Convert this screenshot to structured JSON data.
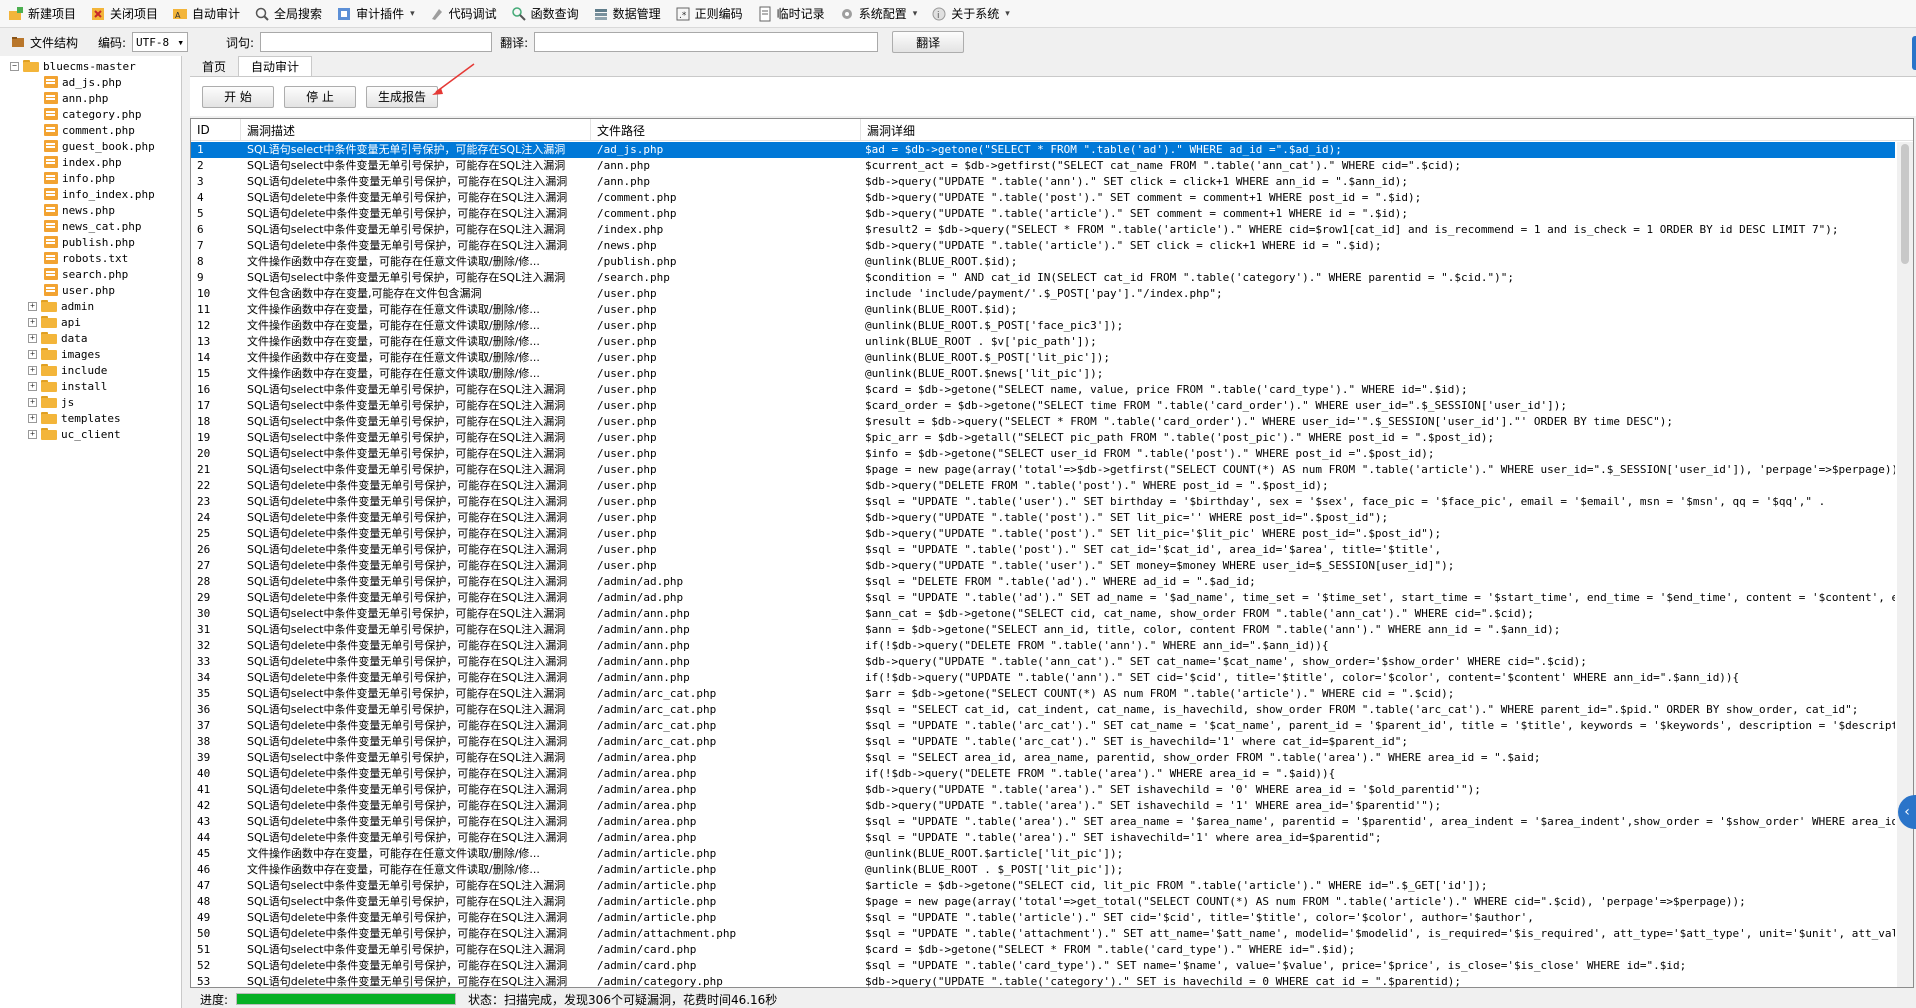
{
  "toolbar": {
    "items": [
      {
        "label": "新建项目",
        "icon": "new-project-icon",
        "caret": false
      },
      {
        "label": "关闭项目",
        "icon": "close-project-icon",
        "caret": false
      },
      {
        "label": "自动审计",
        "icon": "auto-audit-icon",
        "caret": false
      },
      {
        "label": "全局搜索",
        "icon": "global-search-icon",
        "caret": false
      },
      {
        "label": "审计插件",
        "icon": "audit-plugin-icon",
        "caret": true
      },
      {
        "label": "代码调试",
        "icon": "code-debug-icon",
        "caret": false
      },
      {
        "label": "函数查询",
        "icon": "function-query-icon",
        "caret": false
      },
      {
        "label": "数据管理",
        "icon": "data-manage-icon",
        "caret": false
      },
      {
        "label": "正则编码",
        "icon": "regex-encode-icon",
        "caret": false
      },
      {
        "label": "临时记录",
        "icon": "temp-record-icon",
        "caret": false
      },
      {
        "label": "系统配置",
        "icon": "system-config-icon",
        "caret": true
      },
      {
        "label": "关于系统",
        "icon": "about-system-icon",
        "caret": true
      }
    ]
  },
  "topbar": {
    "panel_title": "文件结构",
    "encoding_label": "编码:",
    "encoding_value": "UTF-8",
    "query_label": "词句:",
    "translate_label": "翻译:",
    "translate_button": "翻译"
  },
  "tree": {
    "root": "bluecms-master",
    "files": [
      "ad_js.php",
      "ann.php",
      "category.php",
      "comment.php",
      "guest_book.php",
      "index.php",
      "info.php",
      "info_index.php",
      "news.php",
      "news_cat.php",
      "publish.php",
      "robots.txt",
      "search.php",
      "user.php"
    ],
    "folders": [
      "admin",
      "api",
      "data",
      "images",
      "include",
      "install",
      "js",
      "templates",
      "uc_client"
    ]
  },
  "tabs": [
    {
      "label": "首页",
      "active": false
    },
    {
      "label": "自动审计",
      "active": true
    }
  ],
  "controls": {
    "start": "开 始",
    "stop": "停 止",
    "report": "生成报告"
  },
  "grid": {
    "columns": [
      "ID",
      "漏洞描述",
      "文件路径",
      "漏洞详细"
    ],
    "selected_index": 0,
    "rows": [
      [
        "1",
        "SQL语句select中条件变量无单引号保护，可能存在SQL注入漏洞",
        "/ad_js.php",
        "$ad = $db->getone(\"SELECT * FROM \".table('ad').\" WHERE ad_id =\".$ad_id);"
      ],
      [
        "2",
        "SQL语句select中条件变量无单引号保护，可能存在SQL注入漏洞",
        "/ann.php",
        "$current_act = $db->getfirst(\"SELECT cat_name FROM \".table('ann_cat').\" WHERE cid=\".$cid);"
      ],
      [
        "3",
        "SQL语句delete中条件变量无单引号保护，可能存在SQL注入漏洞",
        "/ann.php",
        "$db->query(\"UPDATE \".table('ann').\" SET click = click+1 WHERE ann_id = \".$ann_id);"
      ],
      [
        "4",
        "SQL语句delete中条件变量无单引号保护，可能存在SQL注入漏洞",
        "/comment.php",
        "$db->query(\"UPDATE \".table('post').\" SET comment = comment+1 WHERE post_id = \".$id);"
      ],
      [
        "5",
        "SQL语句delete中条件变量无单引号保护，可能存在SQL注入漏洞",
        "/comment.php",
        "$db->query(\"UPDATE \".table('article').\" SET comment = comment+1 WHERE id = \".$id);"
      ],
      [
        "6",
        "SQL语句select中条件变量无单引号保护，可能存在SQL注入漏洞",
        "/index.php",
        "$result2 = $db->query(\"SELECT * FROM \".table('article').\" WHERE cid=$row1[cat_id] and is_recommend = 1 and is_check = 1 ORDER BY id DESC LIMIT 7\");"
      ],
      [
        "7",
        "SQL语句delete中条件变量无单引号保护，可能存在SQL注入漏洞",
        "/news.php",
        "$db->query(\"UPDATE \".table('article').\" SET click = click+1 WHERE id = \".$id);"
      ],
      [
        "8",
        "文件操作函数中存在变量，可能存在任意文件读取/删除/修...",
        "/publish.php",
        "@unlink(BLUE_ROOT.$id);"
      ],
      [
        "9",
        "SQL语句select中条件变量无单引号保护，可能存在SQL注入漏洞",
        "/search.php",
        "$condition = \" AND cat_id IN(SELECT cat_id FROM \".table('category').\" WHERE parentid = \".$cid.\")\";"
      ],
      [
        "10",
        "文件包含函数中存在变量,可能存在文件包含漏洞",
        "/user.php",
        "include 'include/payment/'.$_POST['pay'].\"/index.php\";"
      ],
      [
        "11",
        "文件操作函数中存在变量，可能存在任意文件读取/删除/修...",
        "/user.php",
        "@unlink(BLUE_ROOT.$id);"
      ],
      [
        "12",
        "文件操作函数中存在变量，可能存在任意文件读取/删除/修...",
        "/user.php",
        "@unlink(BLUE_ROOT.$_POST['face_pic3']);"
      ],
      [
        "13",
        "文件操作函数中存在变量，可能存在任意文件读取/删除/修...",
        "/user.php",
        "unlink(BLUE_ROOT . $v['pic_path']);"
      ],
      [
        "14",
        "文件操作函数中存在变量，可能存在任意文件读取/删除/修...",
        "/user.php",
        "@unlink(BLUE_ROOT.$_POST['lit_pic']);"
      ],
      [
        "15",
        "文件操作函数中存在变量，可能存在任意文件读取/删除/修...",
        "/user.php",
        "@unlink(BLUE_ROOT.$news['lit_pic']);"
      ],
      [
        "16",
        "SQL语句select中条件变量无单引号保护，可能存在SQL注入漏洞",
        "/user.php",
        "$card = $db->getone(\"SELECT name, value, price FROM \".table('card_type').\" WHERE id=\".$id);"
      ],
      [
        "17",
        "SQL语句select中条件变量无单引号保护，可能存在SQL注入漏洞",
        "/user.php",
        "$card_order = $db->getone(\"SELECT time FROM \".table('card_order').\" WHERE user_id=\".$_SESSION['user_id']);"
      ],
      [
        "18",
        "SQL语句select中条件变量无单引号保护，可能存在SQL注入漏洞",
        "/user.php",
        "$result = $db->query(\"SELECT * FROM \".table('card_order').\" WHERE user_id='\".$_SESSION['user_id'].\"' ORDER BY time DESC\");"
      ],
      [
        "19",
        "SQL语句select中条件变量无单引号保护，可能存在SQL注入漏洞",
        "/user.php",
        "$pic_arr = $db->getall(\"SELECT pic_path FROM \".table('post_pic').\" WHERE post_id = \".$post_id);"
      ],
      [
        "20",
        "SQL语句select中条件变量无单引号保护，可能存在SQL注入漏洞",
        "/user.php",
        "$info = $db->getone(\"SELECT user_id FROM \".table('post').\" WHERE post_id =\".$post_id);"
      ],
      [
        "21",
        "SQL语句select中条件变量无单引号保护，可能存在SQL注入漏洞",
        "/user.php",
        "$page = new page(array('total'=>$db->getfirst(\"SELECT COUNT(*) AS num FROM \".table('article').\" WHERE user_id=\".$_SESSION['user_id']), 'perpage'=>$perpage));"
      ],
      [
        "22",
        "SQL语句delete中条件变量无单引号保护，可能存在SQL注入漏洞",
        "/user.php",
        "$db->query(\"DELETE FROM \".table('post').\" WHERE post_id = \".$post_id);"
      ],
      [
        "23",
        "SQL语句delete中条件变量无单引号保护，可能存在SQL注入漏洞",
        "/user.php",
        "$sql = \"UPDATE \".table('user').\" SET birthday = '$birthday', sex = '$sex', face_pic = '$face_pic', email = '$email', msn = '$msn', qq = '$qq',\" ."
      ],
      [
        "24",
        "SQL语句delete中条件变量无单引号保护，可能存在SQL注入漏洞",
        "/user.php",
        "$db->query(\"UPDATE \".table('post').\" SET lit_pic='' WHERE post_id=\".$post_id\");"
      ],
      [
        "25",
        "SQL语句delete中条件变量无单引号保护，可能存在SQL注入漏洞",
        "/user.php",
        "$db->query(\"UPDATE \".table('post').\" SET lit_pic='$lit_pic' WHERE post_id=\".$post_id\");"
      ],
      [
        "26",
        "SQL语句delete中条件变量无单引号保护，可能存在SQL注入漏洞",
        "/user.php",
        "$sql = \"UPDATE \".table('post').\" SET cat_id='$cat_id', area_id='$area', title='$title',"
      ],
      [
        "27",
        "SQL语句delete中条件变量无单引号保护，可能存在SQL注入漏洞",
        "/user.php",
        "$db->query(\"UPDATE \".table('user').\" SET money=$money WHERE user_id=$_SESSION[user_id]\");"
      ],
      [
        "28",
        "SQL语句delete中条件变量无单引号保护，可能存在SQL注入漏洞",
        "/admin/ad.php",
        "$sql = \"DELETE FROM \".table('ad').\" WHERE ad_id = \".$ad_id;"
      ],
      [
        "29",
        "SQL语句delete中条件变量无单引号保护，可能存在SQL注入漏洞",
        "/admin/ad.php",
        "$sql = \"UPDATE \".table('ad').\" SET ad_name = '$ad_name', time_set = '$time_set', start_time = '$start_time', end_time = '$end_time', content = '$content', exp_content ..."
      ],
      [
        "30",
        "SQL语句select中条件变量无单引号保护，可能存在SQL注入漏洞",
        "/admin/ann.php",
        "$ann_cat = $db->getone(\"SELECT cid, cat_name, show_order FROM \".table('ann_cat').\" WHERE cid=\".$cid);"
      ],
      [
        "31",
        "SQL语句select中条件变量无单引号保护，可能存在SQL注入漏洞",
        "/admin/ann.php",
        "$ann = $db->getone(\"SELECT ann_id, title, color, content FROM \".table('ann').\" WHERE ann_id = \".$ann_id);"
      ],
      [
        "32",
        "SQL语句delete中条件变量无单引号保护，可能存在SQL注入漏洞",
        "/admin/ann.php",
        "if(!$db->query(\"DELETE FROM \".table('ann').\" WHERE ann_id=\".$ann_id)){"
      ],
      [
        "33",
        "SQL语句delete中条件变量无单引号保护，可能存在SQL注入漏洞",
        "/admin/ann.php",
        "$db->query(\"UPDATE \".table('ann_cat').\" SET cat_name='$cat_name', show_order='$show_order' WHERE cid=\".$cid);"
      ],
      [
        "34",
        "SQL语句delete中条件变量无单引号保护，可能存在SQL注入漏洞",
        "/admin/ann.php",
        "if(!$db->query(\"UPDATE \".table('ann').\" SET cid='$cid', title='$title', color='$color', content='$content' WHERE ann_id=\".$ann_id)){"
      ],
      [
        "35",
        "SQL语句select中条件变量无单引号保护，可能存在SQL注入漏洞",
        "/admin/arc_cat.php",
        "$arr = $db->getone(\"SELECT COUNT(*) AS num FROM \".table('article').\" WHERE cid = \".$cid);"
      ],
      [
        "36",
        "SQL语句select中条件变量无单引号保护，可能存在SQL注入漏洞",
        "/admin/arc_cat.php",
        "$sql = \"SELECT cat_id, cat_indent, cat_name, is_havechild, show_order FROM \".table('arc_cat').\" WHERE parent_id=\".$pid.\" ORDER BY show_order, cat_id\";"
      ],
      [
        "37",
        "SQL语句delete中条件变量无单引号保护，可能存在SQL注入漏洞",
        "/admin/arc_cat.php",
        "$sql = \"UPDATE \".table('arc_cat').\" SET cat_name = '$cat_name',  parent_id = '$parent_id', title = '$title', keywords = '$keywords', description = '$description', cat_..."
      ],
      [
        "38",
        "SQL语句delete中条件变量无单引号保护，可能存在SQL注入漏洞",
        "/admin/arc_cat.php",
        "$sql = \"UPDATE \".table('arc_cat').\" SET is_havechild='1' where cat_id=$parent_id\";"
      ],
      [
        "39",
        "SQL语句select中条件变量无单引号保护，可能存在SQL注入漏洞",
        "/admin/area.php",
        "$sql = \"SELECT area_id, area_name, parentid, show_order FROM \".table('area').\" WHERE area_id = \".$aid;"
      ],
      [
        "40",
        "SQL语句delete中条件变量无单引号保护，可能存在SQL注入漏洞",
        "/admin/area.php",
        "if(!$db->query(\"DELETE FROM \".table('area').\" WHERE area_id = \".$aid)){"
      ],
      [
        "41",
        "SQL语句delete中条件变量无单引号保护，可能存在SQL注入漏洞",
        "/admin/area.php",
        "$db->query(\"UPDATE \".table('area').\" SET ishavechild = '0' WHERE area_id = '$old_parentid'\");"
      ],
      [
        "42",
        "SQL语句delete中条件变量无单引号保护，可能存在SQL注入漏洞",
        "/admin/area.php",
        "$db->query(\"UPDATE \".table('area').\" SET ishavechild = '1' WHERE area_id='$parentid'\");"
      ],
      [
        "43",
        "SQL语句delete中条件变量无单引号保护，可能存在SQL注入漏洞",
        "/admin/area.php",
        "$sql = \"UPDATE \".table('area').\" SET area_name = '$area_name', parentid = '$parentid', area_indent = '$area_indent',show_order = '$show_order' WHERE area_id = \".$aid;"
      ],
      [
        "44",
        "SQL语句delete中条件变量无单引号保护，可能存在SQL注入漏洞",
        "/admin/area.php",
        "$sql = \"UPDATE \".table('area').\" SET ishavechild='1' where area_id=$parentid\";"
      ],
      [
        "45",
        "文件操作函数中存在变量，可能存在任意文件读取/删除/修...",
        "/admin/article.php",
        "@unlink(BLUE_ROOT.$article['lit_pic']);"
      ],
      [
        "46",
        "文件操作函数中存在变量，可能存在任意文件读取/删除/修...",
        "/admin/article.php",
        "@unlink(BLUE_ROOT . $_POST['lit_pic']);"
      ],
      [
        "47",
        "SQL语句select中条件变量无单引号保护，可能存在SQL注入漏洞",
        "/admin/article.php",
        "$article = $db->getone(\"SELECT cid, lit_pic FROM \".table('article').\" WHERE id=\".$_GET['id']);"
      ],
      [
        "48",
        "SQL语句select中条件变量无单引号保护，可能存在SQL注入漏洞",
        "/admin/article.php",
        "$page = new page(array('total'=>get_total(\"SELECT COUNT(*) AS num FROM \".table('article').\" WHERE cid=\".$cid), 'perpage'=>$perpage));"
      ],
      [
        "49",
        "SQL语句delete中条件变量无单引号保护，可能存在SQL注入漏洞",
        "/admin/article.php",
        "$sql = \"UPDATE \".table('article').\" SET cid='$cid', title='$title', color='$color', author='$author',"
      ],
      [
        "50",
        "SQL语句delete中条件变量无单引号保护，可能存在SQL注入漏洞",
        "/admin/attachment.php",
        "$sql = \"UPDATE \".table('attachment').\" SET att_name='$att_name', modelid='$modelid', is_required='$is_required', att_type='$att_type', unit='$unit', att_val='$att_val'..."
      ],
      [
        "51",
        "SQL语句select中条件变量无单引号保护，可能存在SQL注入漏洞",
        "/admin/card.php",
        "$card = $db->getone(\"SELECT * FROM \".table('card_type').\" WHERE id=\".$id);"
      ],
      [
        "52",
        "SQL语句delete中条件变量无单引号保护，可能存在SQL注入漏洞",
        "/admin/card.php",
        "$sql = \"UPDATE \".table('card_type').\" SET name='$name', value='$value', price='$price', is_close='$is_close' WHERE id=\".$id;"
      ],
      [
        "53",
        "SQL语句delete中条件变量无单引号保护，可能存在SQL注入漏洞",
        "/admin/category.php",
        "$db->query(\"UPDATE \".table('category').\" SET is_havechild = 0 WHERE cat_id = \".$parentid);"
      ]
    ]
  },
  "status": {
    "progress_label": "进度:",
    "progress_fraction": 1.0,
    "status_text": "状态：扫描完成，发现306个可疑漏洞，花费时间46.16秒"
  },
  "colors": {
    "selection": "#0078d7",
    "progress": "#06b025",
    "accent": "#2a74c9"
  }
}
